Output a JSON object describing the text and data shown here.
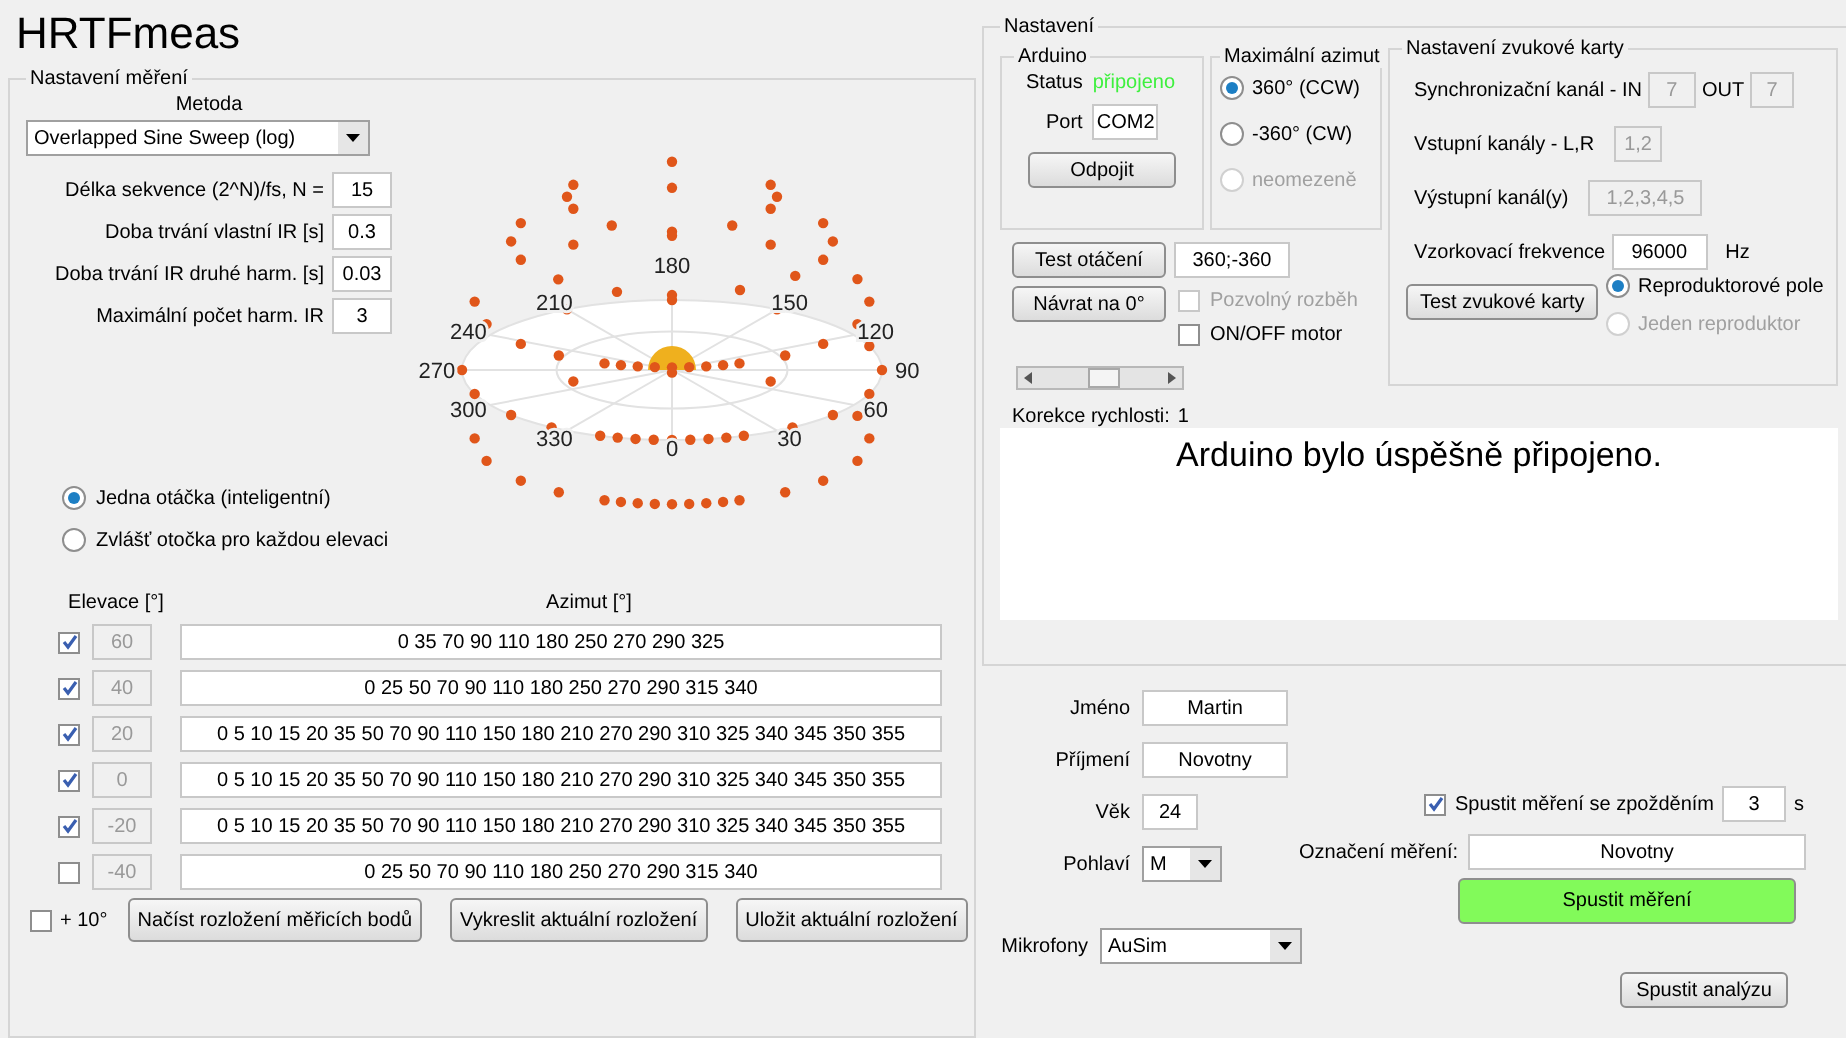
{
  "app_title": "HRTFmeas",
  "measurement": {
    "title": "Nastavení měření",
    "method_label": "Metoda",
    "method": "Overlapped Sine Sweep (log)",
    "params": [
      {
        "label": "Délka sekvence (2^N)/fs, N =",
        "value": "15"
      },
      {
        "label": "Doba trvání vlastní IR [s]",
        "value": "0.3"
      },
      {
        "label": "Doba trvání IR druhé harm. [s]",
        "value": "0.03"
      },
      {
        "label": "Maximální počet harm. IR",
        "value": "3"
      }
    ],
    "rotation_options": [
      {
        "label": "Jedna otáčka (inteligentní)",
        "selected": true
      },
      {
        "label": "Zvlášť otočka pro každou elevaci",
        "selected": false
      }
    ],
    "plot": {
      "azimuth_labels": [
        "0",
        "30",
        "60",
        "90",
        "120",
        "150",
        "180",
        "210",
        "240",
        "270",
        "300",
        "330"
      ]
    },
    "table": {
      "columns": [
        "Elevace [°]",
        "Azimut [°]"
      ],
      "rows": [
        {
          "checked": true,
          "elevation": "60",
          "azimuths": "0 35 70 90 110 180 250 270 290 325"
        },
        {
          "checked": true,
          "elevation": "40",
          "azimuths": "0 25 50 70 90 110 180 250 270 290 315 340"
        },
        {
          "checked": true,
          "elevation": "20",
          "azimuths": "0 5 10 15 20 35 50 70 90 110 150 180 210 270 290 310 325 340 345 350 355"
        },
        {
          "checked": true,
          "elevation": "0",
          "azimuths": "0 5 10 15 20 35 50 70 90 110 150 180 210 270 290 310 325 340 345 350 355"
        },
        {
          "checked": true,
          "elevation": "-20",
          "azimuths": "0 5 10 15 20 35 50 70 90 110 150 180 210 270 290 310 325 340 345 350 355"
        },
        {
          "checked": false,
          "elevation": "-40",
          "azimuths": "0 25 50 70 90 110 180 250 270 290 315 340"
        }
      ]
    },
    "plus10": {
      "label": "+ 10°",
      "checked": false
    },
    "buttons": [
      "Načíst rozložení měřicích bodů",
      "Vykreslit aktuální rozložení",
      "Uložit aktuální rozložení"
    ]
  },
  "settings": {
    "title": "Nastavení",
    "arduino": {
      "title": "Arduino",
      "status_label": "Status",
      "status": "připojeno",
      "port_label": "Port",
      "port": "COM2",
      "button": "Odpojit"
    },
    "max_azimuth": {
      "title": "Maximální azimut",
      "options": [
        {
          "label": "360° (CCW)",
          "selected": true,
          "disabled": false
        },
        {
          "label": "-360° (CW)",
          "selected": false,
          "disabled": false
        },
        {
          "label": "neomezeně",
          "selected": false,
          "disabled": true
        }
      ]
    },
    "rotation_test": {
      "button": "Test otáčení",
      "value": "360;-360"
    },
    "home_button": "Návrat na 0°",
    "motor_options": [
      {
        "label": "Pozvolný rozběh",
        "checked": false,
        "disabled": true
      },
      {
        "label": "ON/OFF motor",
        "checked": false,
        "disabled": false
      }
    ],
    "speed": {
      "level": 0.55,
      "label": "Korekce rychlosti:",
      "value": "1"
    },
    "sound_card": {
      "title": "Nastavení zvukové karty",
      "sync_label": "Synchronizační kanál - IN",
      "sync_in": "7",
      "out_label": "OUT",
      "sync_out": "7",
      "inputs_label": "Vstupní kanály - L,R",
      "inputs": "1,2",
      "outputs_label": "Výstupní kanál(y)",
      "outputs": "1,2,3,4,5",
      "rate_label": "Vzorkovací frekvence",
      "rate": "96000",
      "rate_unit": "Hz",
      "button": "Test zvukové karty",
      "options": [
        {
          "label": "Reproduktorové pole",
          "selected": true,
          "disabled": false
        },
        {
          "label": "Jeden reproduktor",
          "selected": false,
          "disabled": true
        }
      ]
    },
    "message": "Arduino bylo úspěšně připojeno."
  },
  "subject": {
    "fields": [
      {
        "label": "Jméno",
        "value": "Martin"
      },
      {
        "label": "Příjmení",
        "value": "Novotny"
      },
      {
        "label": "Věk",
        "value": "24"
      }
    ],
    "gender_label": "Pohlaví",
    "gender": "M",
    "mic_label": "Mikrofony",
    "mic": "AuSim",
    "delay": {
      "label": "Spustit měření se zpožděním",
      "checked": true,
      "value": "3",
      "unit": "s"
    },
    "tag_label": "Označení měření:",
    "tag": "Novotny",
    "start_button": "Spustit měření",
    "analysis_button": "Spustit analýzu"
  }
}
